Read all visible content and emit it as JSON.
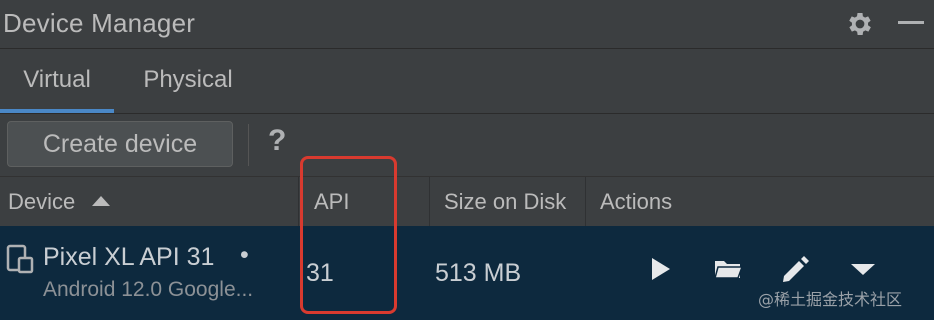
{
  "window": {
    "title": "Device Manager",
    "icons": [
      "gear-icon",
      "minimize-icon"
    ]
  },
  "tabs": [
    {
      "label": "Virtual",
      "selected": true
    },
    {
      "label": "Physical",
      "selected": false
    }
  ],
  "toolbar": {
    "create_label": "Create device",
    "help_label": "?"
  },
  "table": {
    "columns": [
      "Device",
      "API",
      "Size on Disk",
      "Actions"
    ],
    "sort": {
      "column": "Device",
      "direction": "ascending"
    },
    "rows": [
      {
        "name": "Pixel XL API 31",
        "status_dot": "•",
        "subtitle": "Android 12.0 Google...",
        "api": "31",
        "size": "513 MB",
        "actions": [
          "play-icon",
          "folder-open-icon",
          "edit-icon",
          "more-dropdown-icon"
        ]
      }
    ]
  },
  "annotation": {
    "highlight_color": "#d83a2f"
  },
  "watermark": "@稀土掘金技术社区",
  "colors": {
    "background": "#3c3f41",
    "selected_row": "#0d293e",
    "tab_underline": "#4a88c7",
    "text": "#bbbbbb"
  }
}
